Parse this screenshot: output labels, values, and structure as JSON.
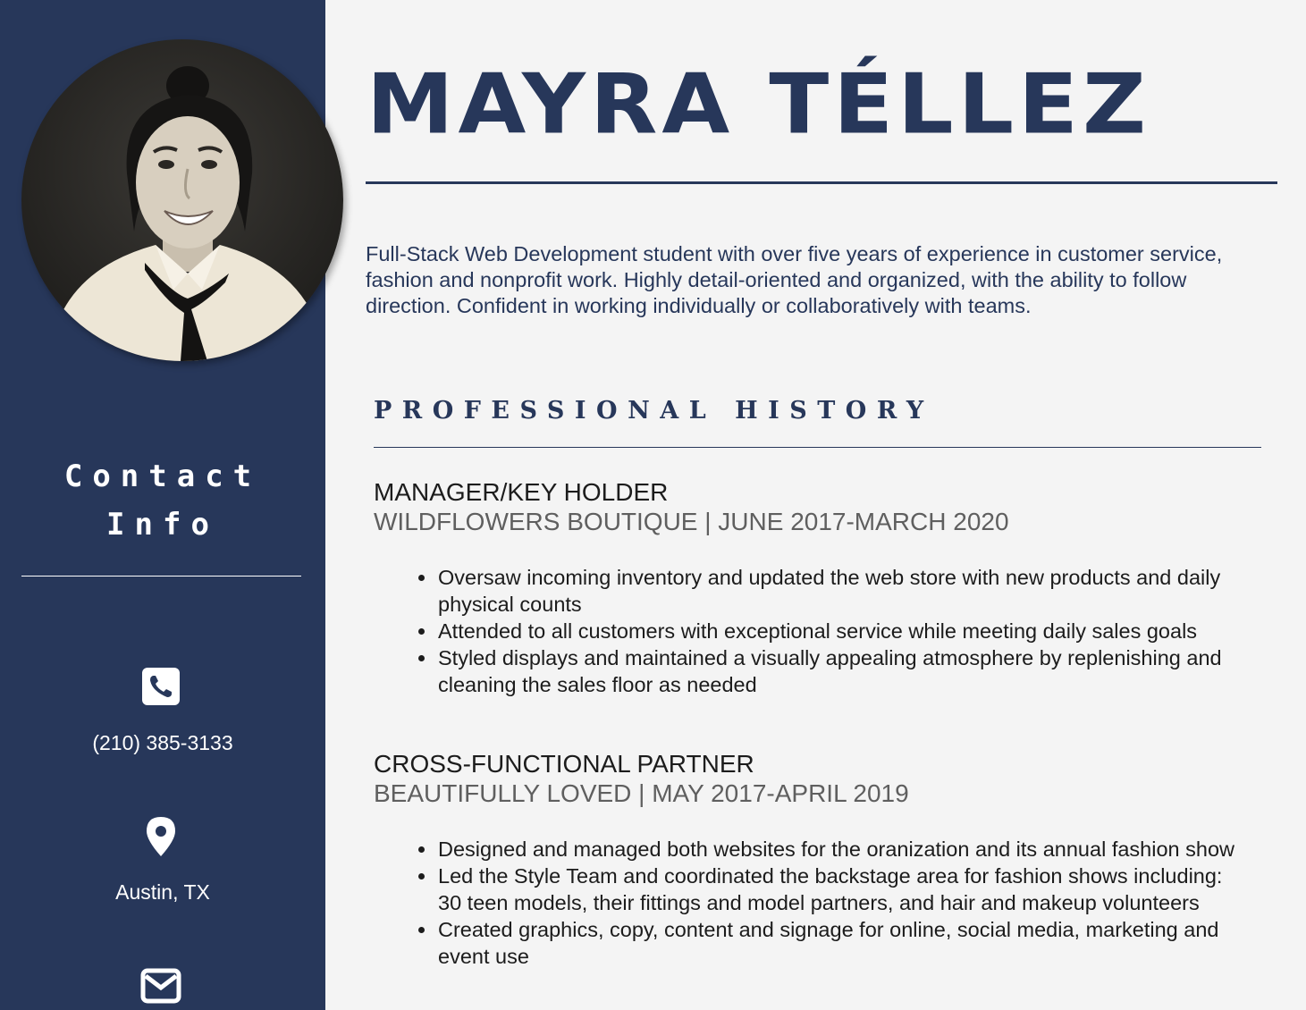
{
  "sidebar": {
    "contact_heading_line1": "Contact",
    "contact_heading_line2": "Info",
    "contacts": [
      {
        "icon": "phone-icon",
        "text": "(210) 385-3133"
      },
      {
        "icon": "map-pin-icon",
        "text": "Austin, TX"
      },
      {
        "icon": "envelope-icon",
        "text": ""
      }
    ]
  },
  "main": {
    "name": "MAYRA TÉLLEZ",
    "summary": "Full-Stack Web Development student with over five years of experience in customer service, fashion and nonprofit work. Highly detail-oriented and organized, with the ability to follow direction. Confident in working individually or collaboratively with teams.",
    "section_title": "PROFESSIONAL HISTORY",
    "jobs": [
      {
        "title": "MANAGER/KEY HOLDER",
        "meta": "WILDFLOWERS BOUTIQUE | JUNE 2017-MARCH 2020",
        "bullets": [
          "Oversaw incoming inventory and updated the web store with new products and daily physical counts",
          "Attended to all customers with exceptional service while meeting daily sales goals",
          "Styled displays and maintained a visually appealing atmosphere by replenishing and cleaning the sales floor as needed"
        ]
      },
      {
        "title": "CROSS-FUNCTIONAL PARTNER",
        "meta": "BEAUTIFULLY LOVED | MAY 2017-APRIL 2019",
        "bullets": [
          "Designed and managed both websites for the oranization and its annual fashion show",
          "Led the Style Team and coordinated the backstage area for fashion shows including: 30 teen models, their fittings and model partners, and hair and makeup volunteers",
          "Created graphics, copy, content and signage for online, social media, marketing and event use"
        ]
      }
    ]
  },
  "colors": {
    "sidebar_bg": "#27375a",
    "page_bg": "#f4f4f4",
    "accent": "#27375a"
  }
}
